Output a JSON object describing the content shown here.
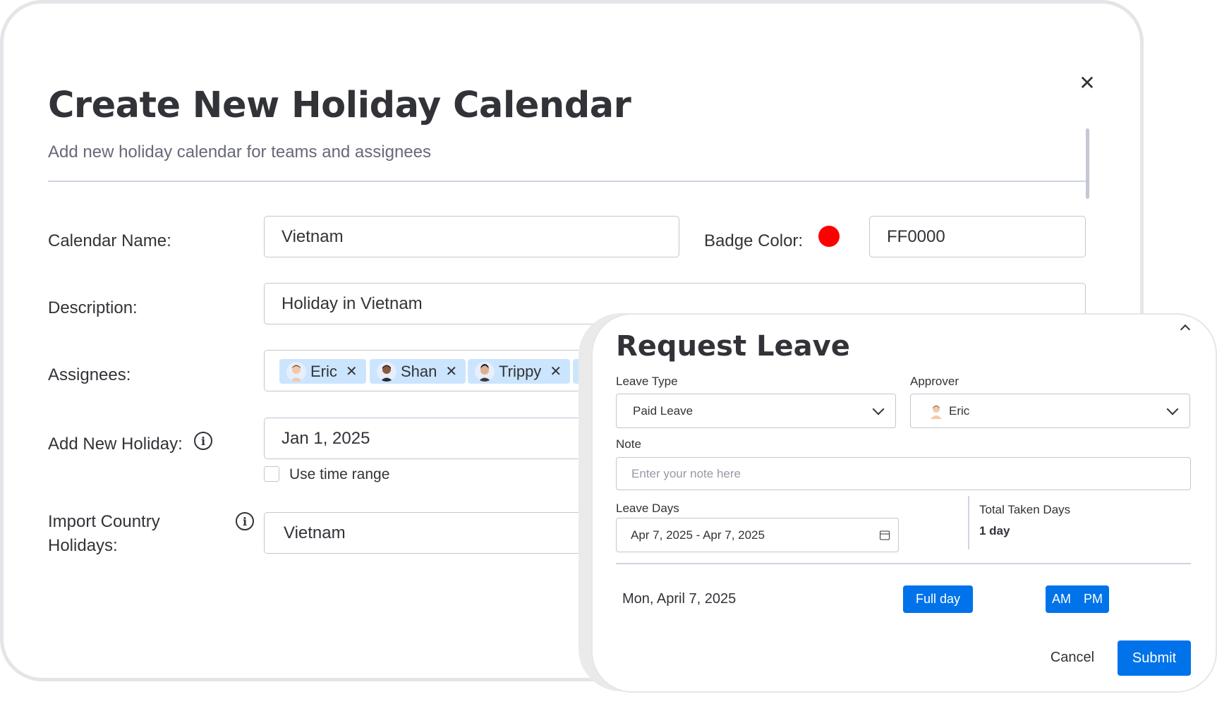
{
  "holiday_calendar": {
    "title": "Create New Holiday Calendar",
    "subtitle": "Add new holiday calendar for teams and assignees",
    "close_icon": "close-icon",
    "calendar_name_label": "Calendar Name:",
    "calendar_name_value": "Vietnam",
    "badge_color_label": "Badge Color:",
    "badge_color": "#FF0000",
    "badge_color_value": "FF0000",
    "description_label": "Description:",
    "description_value": "Holiday in Vietnam",
    "assignees_label": "Assignees:",
    "assignees": [
      {
        "name": "Eric"
      },
      {
        "name": "Shan"
      },
      {
        "name": "Trippy"
      }
    ],
    "add_holiday_label": "Add New Holiday:",
    "add_holiday_value": "Jan 1, 2025",
    "use_time_range_label": "Use time range",
    "import_label": "Import Country Holidays:",
    "import_value": "Vietnam"
  },
  "request_leave": {
    "title": "Request Leave",
    "leave_type_label": "Leave Type",
    "leave_type_value": "Paid Leave",
    "approver_label": "Approver",
    "approver_value": "Eric",
    "note_label": "Note",
    "note_placeholder": "Enter your note here",
    "leave_days_label": "Leave Days",
    "leave_days_value": "Apr 7, 2025 - Apr 7, 2025",
    "total_taken_label": "Total Taken Days",
    "total_taken_value": "1 day",
    "day_label": "Mon, April 7, 2025",
    "full_day_label": "Full day",
    "am_label": "AM",
    "pm_label": "PM",
    "cancel_label": "Cancel",
    "submit_label": "Submit"
  },
  "colors": {
    "accent": "#0073ea",
    "chip_bg": "#cce5ff",
    "badge": "#ff0000"
  }
}
